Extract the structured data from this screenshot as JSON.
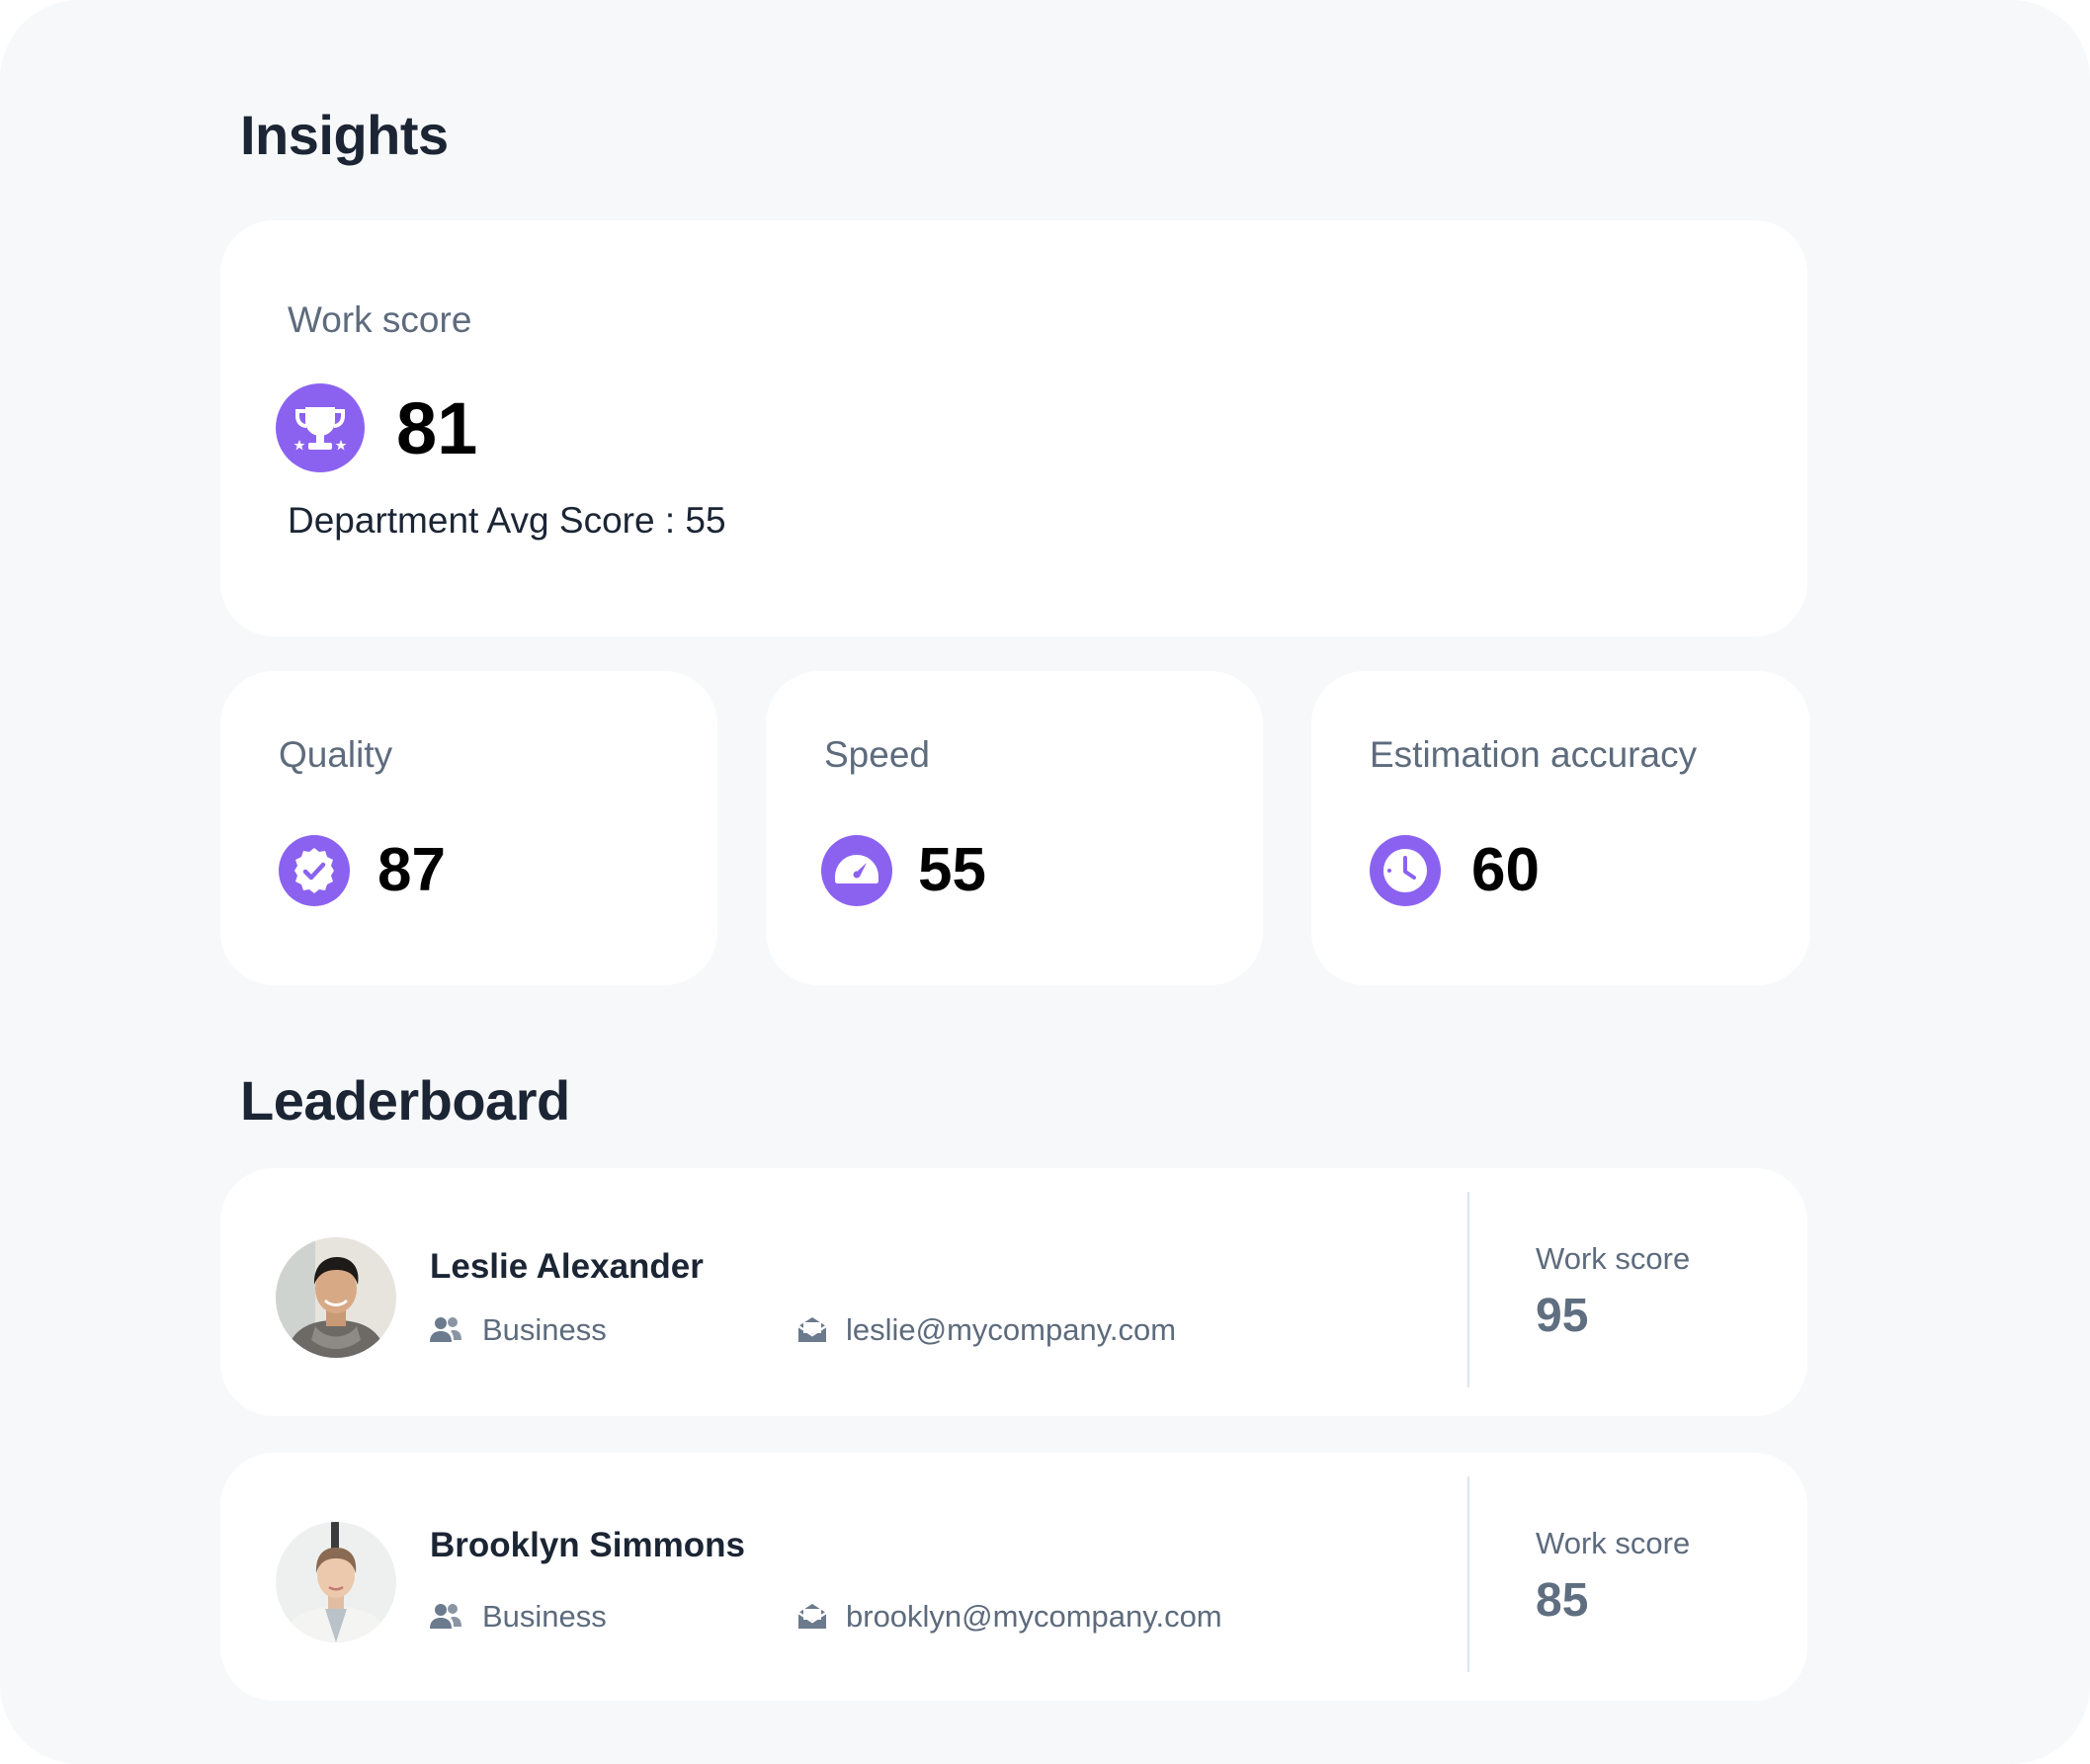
{
  "insights": {
    "title": "Insights",
    "work_score": {
      "label": "Work score",
      "value": "81",
      "department_avg": "Department Avg Score : 55",
      "icon": "trophy-icon"
    },
    "metrics": [
      {
        "label": "Quality",
        "value": "87",
        "icon": "verified-badge-icon"
      },
      {
        "label": "Speed",
        "value": "55",
        "icon": "speedometer-icon"
      },
      {
        "label": "Estimation accuracy",
        "value": "60",
        "icon": "clock-icon"
      }
    ]
  },
  "leaderboard": {
    "title": "Leaderboard",
    "rows": [
      {
        "name": "Leslie Alexander",
        "department": "Business",
        "email": "leslie@mycompany.com",
        "score_label": "Work score",
        "score": "95"
      },
      {
        "name": "Brooklyn Simmons",
        "department": "Business",
        "email": "brooklyn@mycompany.com",
        "score_label": "Work score",
        "score": "85"
      }
    ]
  },
  "colors": {
    "accent": "#8b62f0",
    "background": "#f7f8fa",
    "card": "#ffffff",
    "muted_text": "#5d6b7d",
    "heading": "#1b2534"
  }
}
